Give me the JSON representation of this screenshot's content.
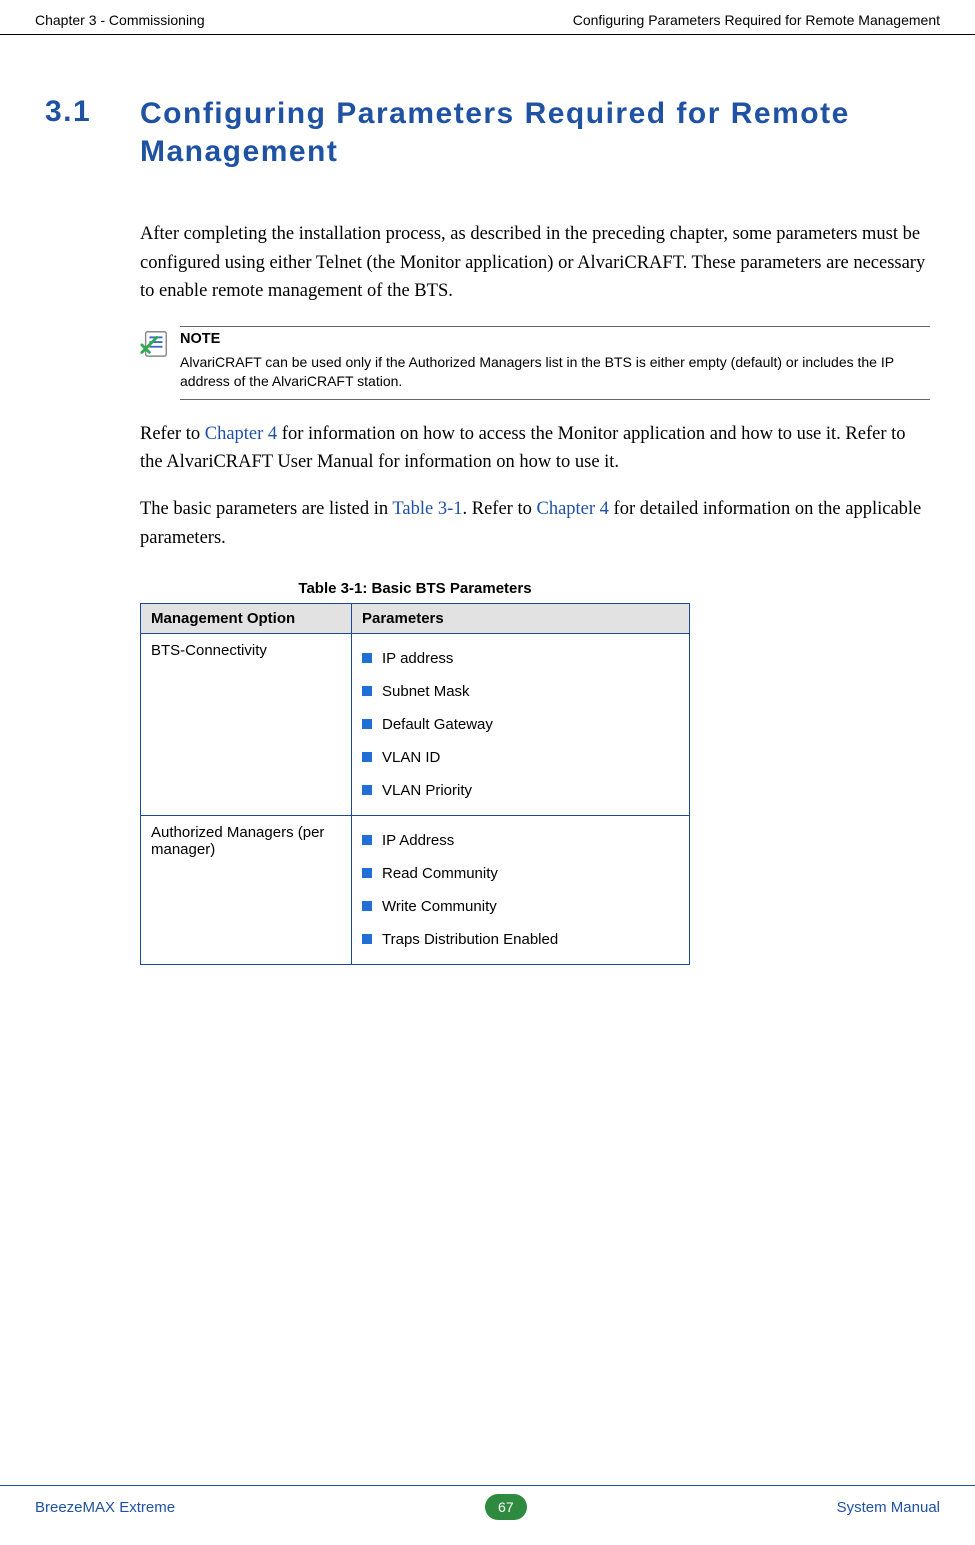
{
  "header": {
    "left": "Chapter 3 - Commissioning",
    "right": "Configuring Parameters Required for Remote Management"
  },
  "section": {
    "number": "3.1",
    "title": "Configuring Parameters Required for Remote Management"
  },
  "para1": "After completing the installation process, as described in the preceding chapter, some parameters must be configured using either Telnet (the Monitor application) or AlvariCRAFT. These parameters are necessary to enable remote management of the BTS.",
  "note": {
    "title": "NOTE",
    "text": "AlvariCRAFT can be used only if the Authorized Managers list in the BTS is either empty (default) or includes the IP address of the AlvariCRAFT station."
  },
  "para2_a": "Refer to ",
  "para2_link1": "Chapter 4",
  "para2_b": " for information on how to access the Monitor application and how to use it. Refer to the AlvariCRAFT User Manual for information on how to use it.",
  "para3_a": "The basic parameters are listed in ",
  "para3_link1": "Table 3-1",
  "para3_b": ". Refer to ",
  "para3_link2": "Chapter 4",
  "para3_c": " for detailed information on the applicable parameters.",
  "table": {
    "caption": "Table 3-1: Basic BTS Parameters",
    "col1": "Management Option",
    "col2": "Parameters",
    "rows": [
      {
        "option": "BTS-Connectivity",
        "params": [
          "IP address",
          "Subnet Mask",
          "Default Gateway",
          "VLAN ID",
          "VLAN Priority"
        ]
      },
      {
        "option": "Authorized Managers (per manager)",
        "params": [
          "IP Address",
          "Read Community",
          "Write Community",
          "Traps Distribution Enabled"
        ]
      }
    ]
  },
  "footer": {
    "left": "BreezeMAX Extreme",
    "page": "67",
    "right": "System Manual"
  }
}
